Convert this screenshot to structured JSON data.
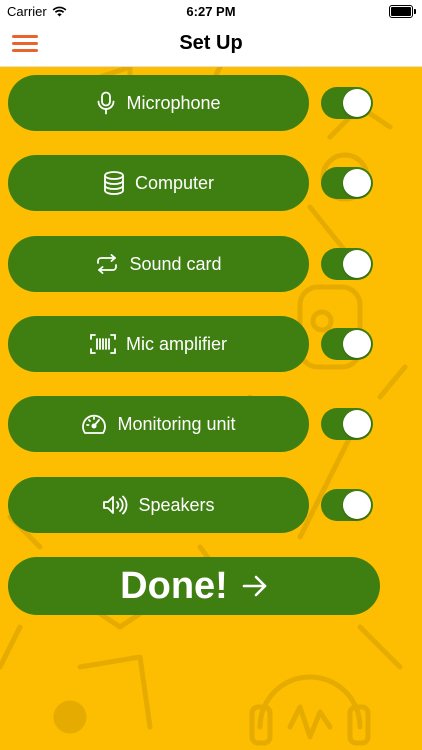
{
  "status_bar": {
    "carrier": "Carrier",
    "time": "6:27 PM"
  },
  "nav": {
    "title": "Set Up"
  },
  "devices": [
    {
      "label": "Microphone",
      "icon": "microphone-icon",
      "enabled": true
    },
    {
      "label": "Computer",
      "icon": "database-icon",
      "enabled": true
    },
    {
      "label": "Sound card",
      "icon": "repeat-icon",
      "enabled": true
    },
    {
      "label": "Mic amplifier",
      "icon": "barcode-icon",
      "enabled": true
    },
    {
      "label": "Monitoring unit",
      "icon": "gauge-icon",
      "enabled": true
    },
    {
      "label": "Speakers",
      "icon": "speaker-icon",
      "enabled": true
    }
  ],
  "done_label": "Done!",
  "colors": {
    "background": "#fdbd00",
    "button": "#3f7f12",
    "menu": "#e8642e"
  }
}
